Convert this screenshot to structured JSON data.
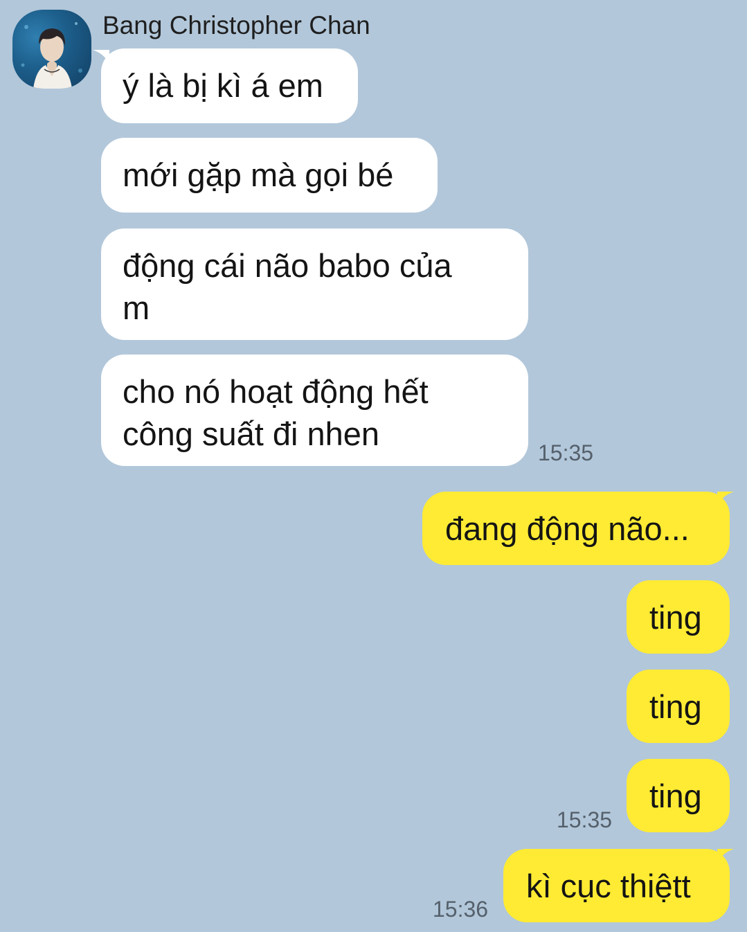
{
  "chat": {
    "sender_name": "Bang Christopher Chan",
    "bubble_colors": {
      "incoming": "#ffffff",
      "outgoing": "#ffeb33",
      "background": "#b2c7da"
    },
    "incoming": [
      {
        "line1": "ý là bị kì á em",
        "line2": ""
      },
      {
        "line1": "mới gặp mà gọi bé",
        "line2": ""
      },
      {
        "line1": "động cái não babo của",
        "line2": "m"
      },
      {
        "line1": "cho nó hoạt động hết",
        "line2": "công suất đi nhen"
      }
    ],
    "incoming_time": "15:35",
    "outgoing": [
      {
        "text": "đang động não..."
      },
      {
        "text": "ting"
      },
      {
        "text": "ting"
      },
      {
        "text": "ting"
      },
      {
        "text": "kì cục thiệtt"
      }
    ],
    "outgoing_time_1": "15:35",
    "outgoing_time_2": "15:36"
  }
}
